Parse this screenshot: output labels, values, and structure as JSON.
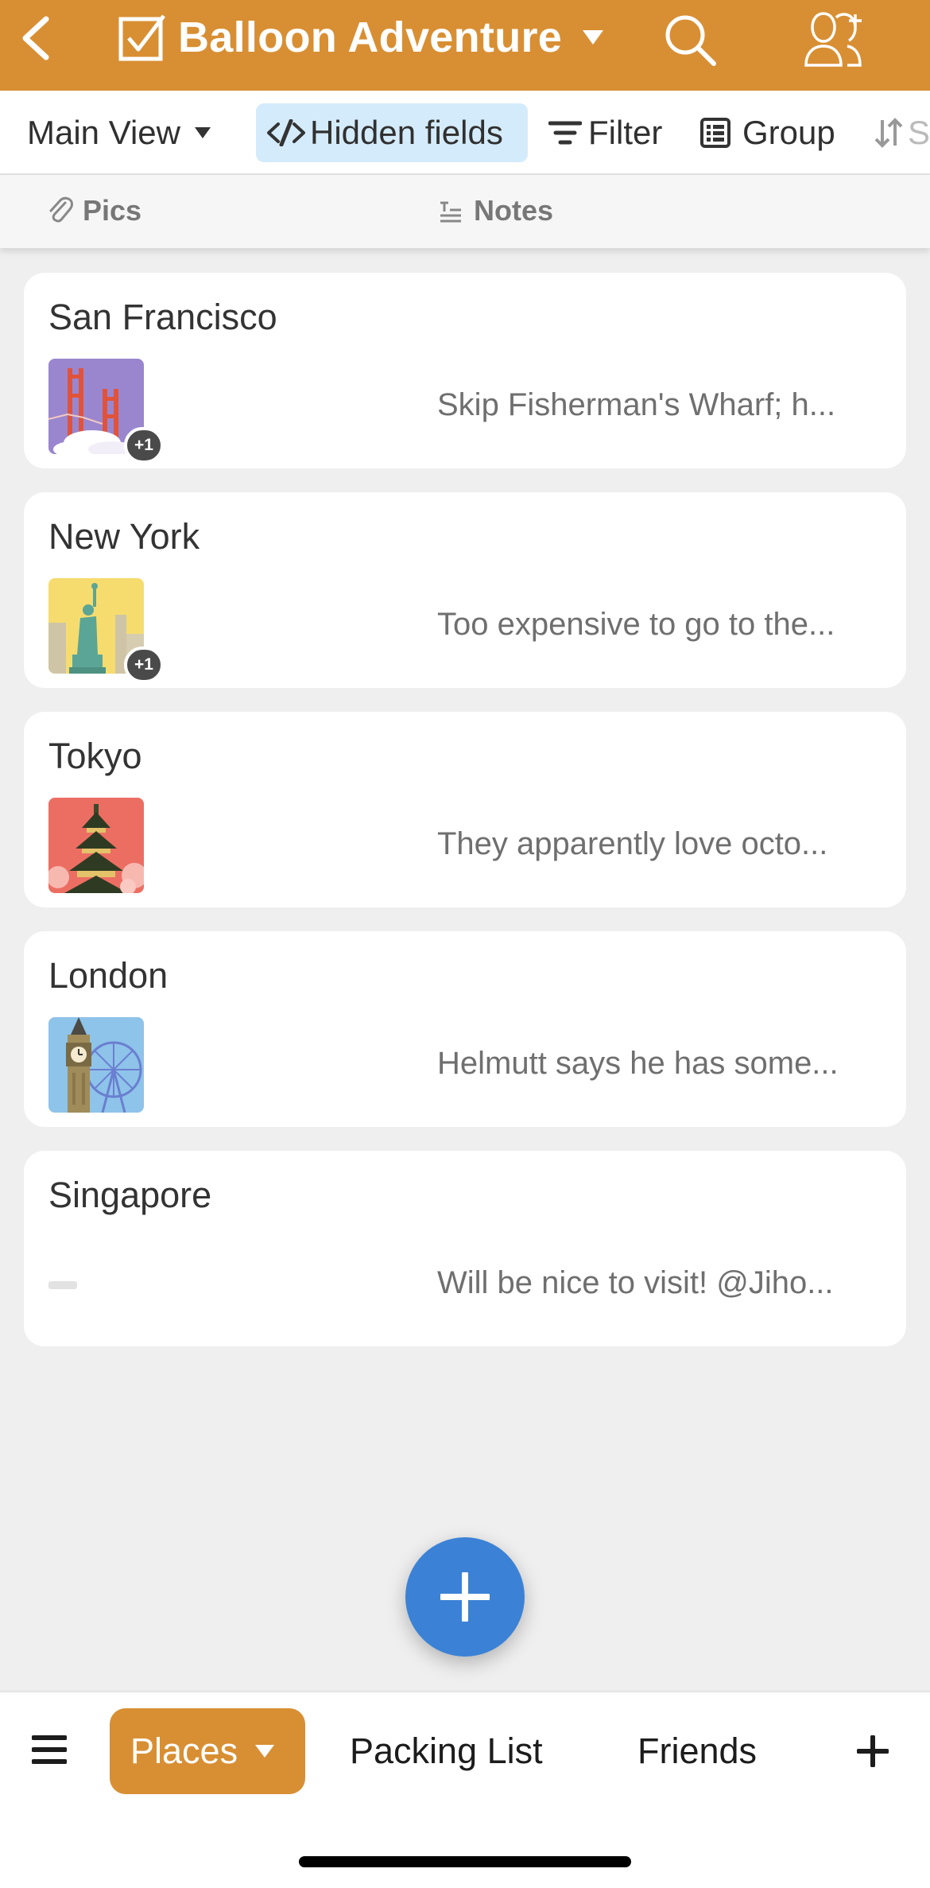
{
  "header": {
    "title": "Balloon Adventure",
    "icons": [
      "back-arrow-icon",
      "checkbox-icon",
      "caret-down-icon",
      "search-icon",
      "add-user-icon"
    ],
    "color": "#d88f33"
  },
  "toolbar": {
    "main_view": "Main View",
    "hidden_fields": "Hidden fields",
    "filter": "Filter",
    "group": "Group",
    "sort": "S"
  },
  "columns": {
    "pics": "Pics",
    "notes": "Notes"
  },
  "records": [
    {
      "title": "San Francisco",
      "note": "Skip Fisherman's Wharf; h...",
      "badge": "+1",
      "image": "golden-gate-bridge"
    },
    {
      "title": "New York",
      "note": "Too expensive to go to the...",
      "badge": "+1",
      "image": "statue-of-liberty"
    },
    {
      "title": "Tokyo",
      "note": "They apparently love octo...",
      "badge": "",
      "image": "pagoda"
    },
    {
      "title": "London",
      "note": "Helmutt says he has some...",
      "badge": "",
      "image": "big-ben"
    },
    {
      "title": "Singapore",
      "note": "Will be nice to visit! @Jiho...",
      "badge": "",
      "image": ""
    }
  ],
  "bottom_tabs": {
    "places": "Places",
    "packing_list": "Packing List",
    "friends": "Friends"
  },
  "colors": {
    "accent": "#d88f33",
    "fab": "#3b82d6",
    "hidden_fields_bg": "#d4ebfb"
  }
}
